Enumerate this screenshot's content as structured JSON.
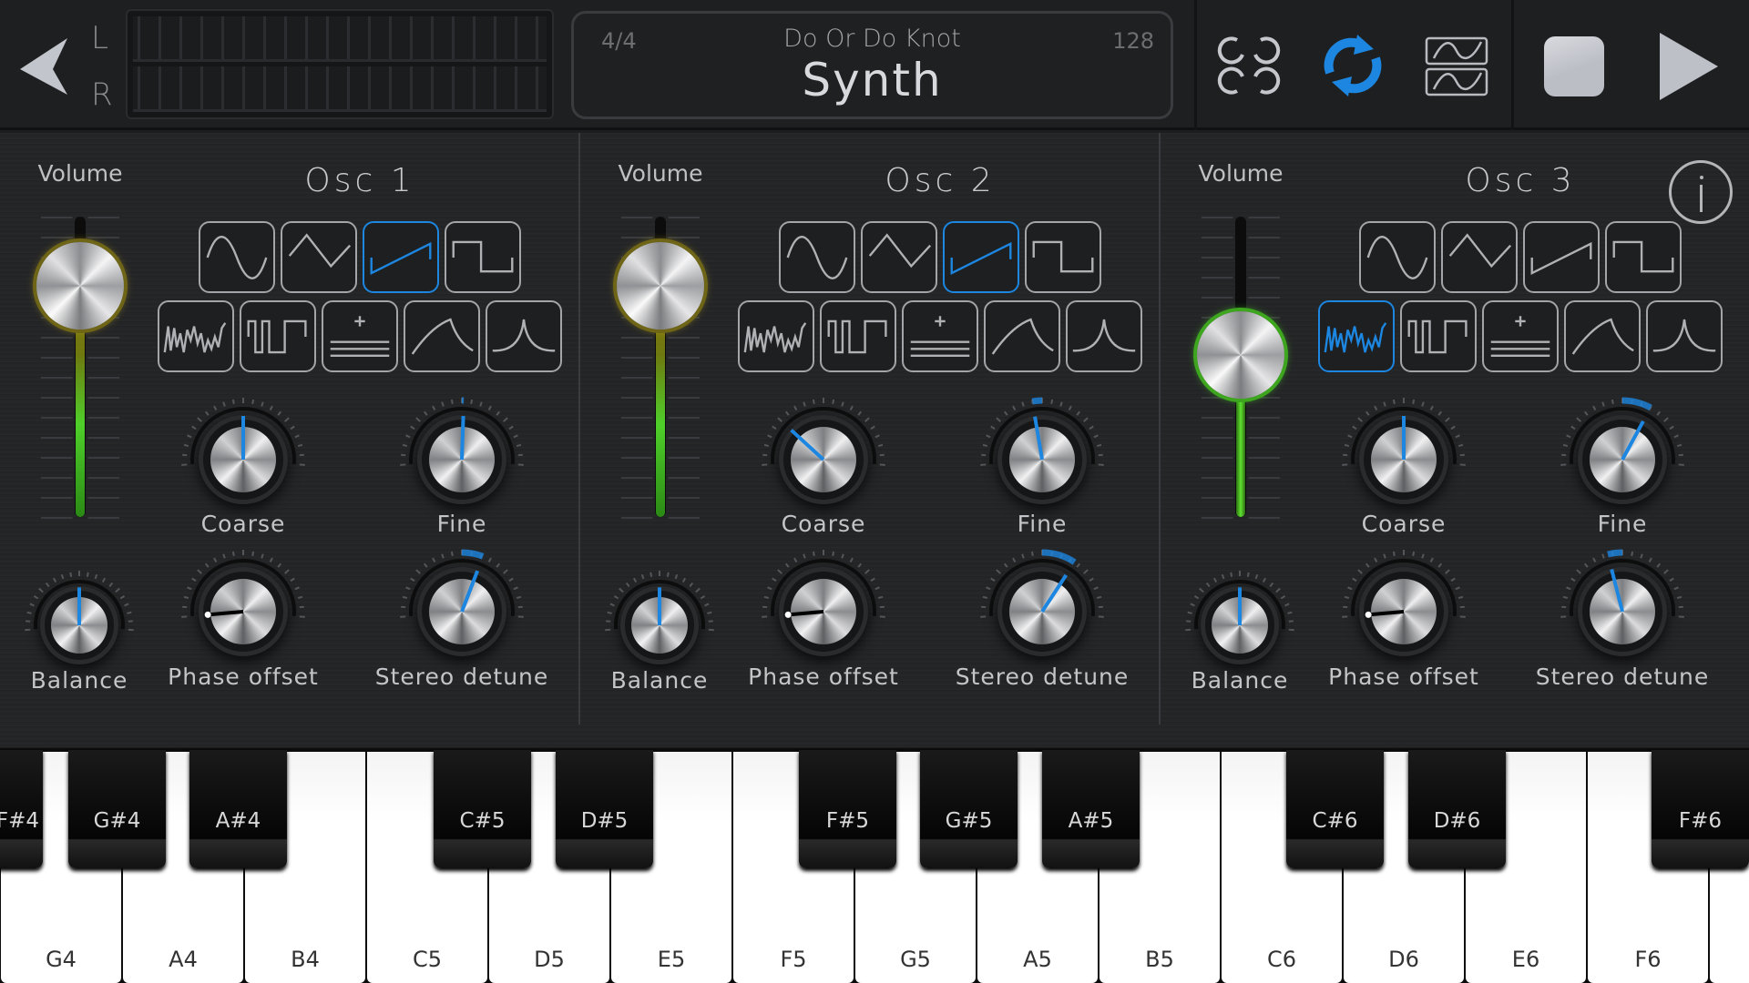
{
  "header": {
    "meter_labels": {
      "left": "L",
      "right": "R"
    },
    "time_signature": "4/4",
    "song_title": "Do Or Do Knot",
    "track_name": "Synth",
    "tempo": "128",
    "icons": [
      "back-arrow-icon",
      "loop-options-icon",
      "sync-icon",
      "dual-wave-icon",
      "stop-icon",
      "play-icon"
    ],
    "sync_active": true,
    "accent_color": "#1c86e0"
  },
  "waveforms": [
    "sine",
    "triangle",
    "sawtooth",
    "square",
    "noise",
    "pulse",
    "additive",
    "attack-decay",
    "peak"
  ],
  "oscillators": [
    {
      "title": "Osc 1",
      "volume_label": "Volume",
      "volume": 0.77,
      "selected_wave": 2,
      "knobs": {
        "coarse": {
          "label": "Coarse",
          "value": 0
        },
        "fine": {
          "label": "Fine",
          "value": 0.02
        },
        "balance": {
          "label": "Balance",
          "value": 0
        },
        "phase_offset": {
          "label": "Phase offset",
          "value": -1
        },
        "stereo_detune": {
          "label": "Stereo detune",
          "value": 0.22
        }
      }
    },
    {
      "title": "Osc 2",
      "volume_label": "Volume",
      "volume": 0.77,
      "selected_wave": 2,
      "knobs": {
        "coarse": {
          "label": "Coarse",
          "value": -0.5
        },
        "fine": {
          "label": "Fine",
          "value": -0.1
        },
        "balance": {
          "label": "Balance",
          "value": 0
        },
        "phase_offset": {
          "label": "Phase offset",
          "value": -1
        },
        "stereo_detune": {
          "label": "Stereo detune",
          "value": 0.35
        }
      }
    },
    {
      "title": "Osc 3",
      "volume_label": "Volume",
      "volume": 0.54,
      "selected_wave": 4,
      "knobs": {
        "coarse": {
          "label": "Coarse",
          "value": 0
        },
        "fine": {
          "label": "Fine",
          "value": 0.3
        },
        "balance": {
          "label": "Balance",
          "value": 0
        },
        "phase_offset": {
          "label": "Phase offset",
          "value": -1
        },
        "stereo_detune": {
          "label": "Stereo detune",
          "value": -0.15
        }
      }
    }
  ],
  "keyboard": {
    "white_keys": [
      "G4",
      "A4",
      "B4",
      "C5",
      "D5",
      "E5",
      "F5",
      "G5",
      "A5",
      "B5",
      "C6",
      "D6",
      "E6",
      "F6",
      ""
    ],
    "black_keys": [
      "F#4",
      "G#4",
      "A#4",
      "C#5",
      "D#5",
      "F#5",
      "G#5",
      "A#5",
      "C#6",
      "D#6",
      "F#6"
    ]
  }
}
